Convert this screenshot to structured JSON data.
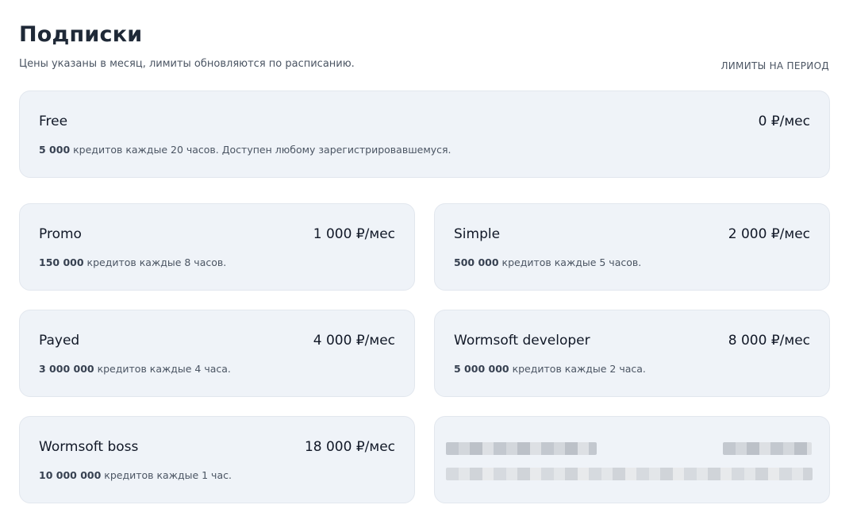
{
  "page": {
    "title": "Подписки",
    "subtitle": "Цены указаны в месяц, лимиты обновляются по расписанию.",
    "limits_link": "ЛИМИТЫ НА ПЕРИОД"
  },
  "plans": [
    {
      "name": "Free",
      "price": "0 ₽/мес",
      "credits": "5 000",
      "desc": " кредитов каждые 20 часов. Доступен любому зарегистрировавшемуся."
    },
    {
      "name": "Promo",
      "price": "1 000 ₽/мес",
      "credits": "150 000",
      "desc": " кредитов каждые 8 часов."
    },
    {
      "name": "Simple",
      "price": "2 000 ₽/мес",
      "credits": "500 000",
      "desc": " кредитов каждые 5 часов."
    },
    {
      "name": "Payed",
      "price": "4 000 ₽/мес",
      "credits": "3 000 000",
      "desc": " кредитов каждые 4 часа."
    },
    {
      "name": "Wormsoft developer",
      "price": "8 000 ₽/мес",
      "credits": "5 000 000",
      "desc": " кредитов каждые 2 часа."
    },
    {
      "name": "Wormsoft boss",
      "price": "18 000 ₽/мес",
      "credits": "10 000 000",
      "desc": " кредитов каждые 1 час."
    }
  ],
  "colors": {
    "card_bg": "#eff3f8",
    "card_border": "#e2e7ee",
    "text_primary": "#111827",
    "text_secondary": "#4b5563"
  }
}
